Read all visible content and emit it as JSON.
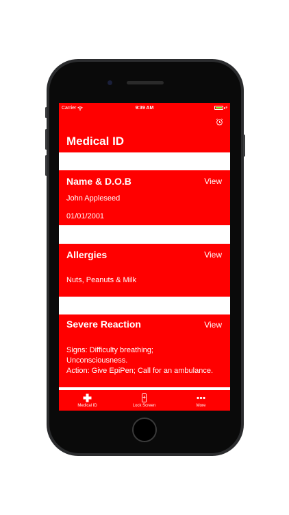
{
  "status": {
    "carrier": "Carrier",
    "time": "9:39 AM"
  },
  "header": {
    "title": "Medical ID"
  },
  "cards": [
    {
      "title": "Name & D.O.B",
      "view": "View",
      "lines": [
        "John Appleseed",
        "01/01/2001"
      ]
    },
    {
      "title": "Allergies",
      "view": "View",
      "lines": [
        "Nuts, Peanuts & Milk"
      ]
    },
    {
      "title": "Severe Reaction",
      "view": "View",
      "lines": [
        "Signs: Difficulty breathing;",
        "Unconsciousness.",
        "Action: Give EpiPen; Call for an ambulance."
      ]
    }
  ],
  "tabs": [
    {
      "label": "Medical ID",
      "icon": "plus-icon"
    },
    {
      "label": "Lock Screen",
      "icon": "phone-icon"
    },
    {
      "label": "More",
      "icon": "more-dots-icon"
    }
  ],
  "colors": {
    "accent": "#ff0000",
    "text": "#ffffff",
    "battery": "#7cff3a"
  }
}
